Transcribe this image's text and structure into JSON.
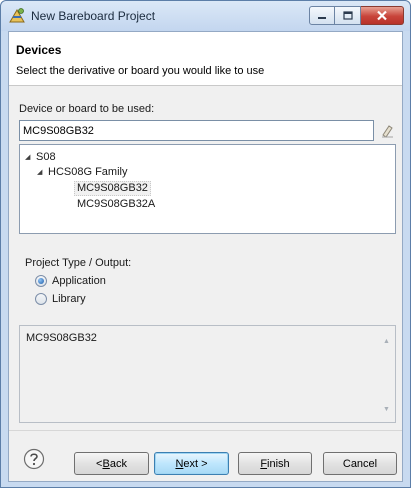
{
  "window": {
    "title": "New Bareboard Project",
    "icon": "project-wizard-icon"
  },
  "header": {
    "title": "Devices",
    "description": "Select the derivative or board you would like to use"
  },
  "device_field": {
    "label": "Device or board to be used:",
    "value": "MC9S08GB32",
    "clear_icon": "eraser-icon"
  },
  "tree": {
    "items": [
      {
        "label": "S08",
        "level": 0,
        "expanded": true
      },
      {
        "label": "HCS08G Family",
        "level": 1,
        "expanded": true
      },
      {
        "label": "MC9S08GB32",
        "level": 2,
        "selected": true
      },
      {
        "label": "MC9S08GB32A",
        "level": 2,
        "selected": false
      }
    ]
  },
  "project_type": {
    "label": "Project Type / Output:",
    "options": [
      {
        "label": "Application",
        "checked": true
      },
      {
        "label": "Library",
        "checked": false
      }
    ]
  },
  "description_area": {
    "text": "MC9S08GB32"
  },
  "buttons": {
    "back_pre": "< ",
    "back_mn": "B",
    "back_post": "ack",
    "next_mn": "N",
    "next_post": "ext >",
    "finish_mn": "F",
    "finish_post": "inish",
    "cancel": "Cancel"
  },
  "colors": {
    "titlebar": "#c3d6ef",
    "close_button": "#c8443a",
    "default_button": "#bee6fd"
  }
}
